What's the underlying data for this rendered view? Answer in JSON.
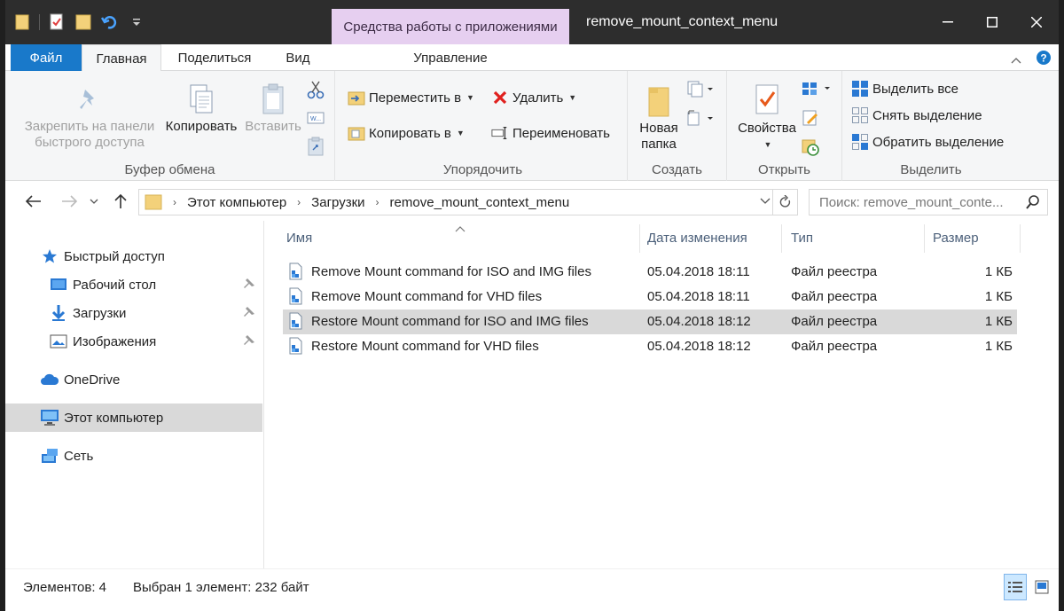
{
  "titlebar": {
    "tools_label": "Средства работы с приложениями",
    "window_title": "remove_mount_context_menu"
  },
  "tabs": {
    "file": "Файл",
    "home": "Главная",
    "share": "Поделиться",
    "view": "Вид",
    "manage": "Управление"
  },
  "ribbon": {
    "clipboard": {
      "pin_line1": "Закрепить на панели",
      "pin_line2": "быстрого доступа",
      "copy": "Копировать",
      "paste": "Вставить",
      "label": "Буфер обмена"
    },
    "organize": {
      "move_to": "Переместить в",
      "copy_to": "Копировать в",
      "delete": "Удалить",
      "rename": "Переименовать",
      "label": "Упорядочить"
    },
    "new": {
      "new_folder_line1": "Новая",
      "new_folder_line2": "папка",
      "label": "Создать"
    },
    "open": {
      "properties": "Свойства",
      "label": "Открыть"
    },
    "select": {
      "select_all": "Выделить все",
      "select_none": "Снять выделение",
      "invert": "Обратить выделение",
      "label": "Выделить"
    }
  },
  "address": {
    "crumbs": [
      "Этот компьютер",
      "Загрузки",
      "remove_mount_context_menu"
    ]
  },
  "search": {
    "placeholder": "Поиск: remove_mount_conte..."
  },
  "navpane": {
    "items": [
      {
        "label": "Быстрый доступ"
      },
      {
        "label": "Рабочий стол"
      },
      {
        "label": "Загрузки"
      },
      {
        "label": "Изображения"
      },
      {
        "label": "OneDrive"
      },
      {
        "label": "Этот компьютер"
      },
      {
        "label": "Сеть"
      }
    ]
  },
  "filelist": {
    "columns": [
      "Имя",
      "Дата изменения",
      "Тип",
      "Размер"
    ],
    "rows": [
      {
        "name": "Remove Mount command for ISO and IMG files",
        "date": "05.04.2018 18:11",
        "type": "Файл реестра",
        "size": "1 КБ"
      },
      {
        "name": "Remove Mount command for VHD files",
        "date": "05.04.2018 18:11",
        "type": "Файл реестра",
        "size": "1 КБ"
      },
      {
        "name": "Restore Mount command for ISO and IMG files",
        "date": "05.04.2018 18:12",
        "type": "Файл реестра",
        "size": "1 КБ"
      },
      {
        "name": "Restore Mount command for VHD files",
        "date": "05.04.2018 18:12",
        "type": "Файл реестра",
        "size": "1 КБ"
      }
    ],
    "selected_index": 2
  },
  "status": {
    "count": "Элементов: 4",
    "selection": "Выбран 1 элемент: 232 байт",
    "view_mode": "details"
  },
  "colors": {
    "accent": "#1979ca",
    "titlebar": "#2d2d2d",
    "tools_tab": "#e6cff0",
    "selection": "#d9d9d9"
  }
}
